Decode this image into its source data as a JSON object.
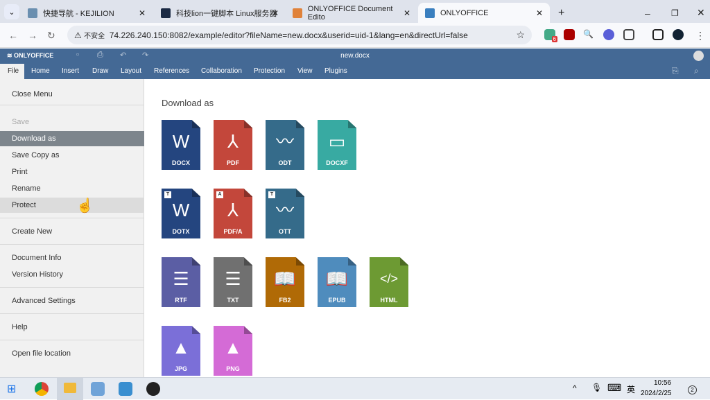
{
  "browser": {
    "tabs": [
      {
        "title": "快捷导航 - KEJILION",
        "color": "#6a8fb0"
      },
      {
        "title": "科技lion一键脚本 Linux服务器",
        "color": "#1b2a44"
      },
      {
        "title": "ONLYOFFICE Document Edito",
        "color": "#e0823a"
      },
      {
        "title": "ONLYOFFICE",
        "color": "#3a7fbf"
      }
    ],
    "new_tab": "+",
    "insecure_label": "不安全",
    "url": "74.226.240.150:8082/example/editor?fileName=new.docx&userid=uid-1&lang=en&directUrl=false",
    "ext_badge": "6"
  },
  "editor": {
    "logo": "ONLYOFFICE",
    "doc_title": "new.docx",
    "tabs": [
      "File",
      "Home",
      "Insert",
      "Draw",
      "Layout",
      "References",
      "Collaboration",
      "Protection",
      "View",
      "Plugins"
    ]
  },
  "menu": {
    "items": [
      {
        "label": "Close Menu",
        "state": ""
      },
      {
        "label": "Save",
        "state": "disabled"
      },
      {
        "label": "Download as",
        "state": "selected"
      },
      {
        "label": "Save Copy as",
        "state": ""
      },
      {
        "label": "Print",
        "state": ""
      },
      {
        "label": "Rename",
        "state": ""
      },
      {
        "label": "Protect",
        "state": "hover"
      },
      {
        "label": "Create New",
        "state": ""
      },
      {
        "label": "Document Info",
        "state": ""
      },
      {
        "label": "Version History",
        "state": ""
      },
      {
        "label": "Advanced Settings",
        "state": ""
      },
      {
        "label": "Help",
        "state": ""
      },
      {
        "label": "Open file location",
        "state": ""
      }
    ]
  },
  "download": {
    "title": "Download as",
    "rows": [
      [
        {
          "label": "DOCX",
          "glyph": "W",
          "color": "#24457f"
        },
        {
          "label": "PDF",
          "glyph": "⅄",
          "color": "#c3473b"
        },
        {
          "label": "ODT",
          "glyph": "〰",
          "color": "#356b8a"
        },
        {
          "label": "DOCXF",
          "glyph": "▭",
          "color": "#38aaa2"
        }
      ],
      [
        {
          "label": "DOTX",
          "glyph": "W",
          "color": "#24457f",
          "badge": "T"
        },
        {
          "label": "PDF/A",
          "glyph": "⅄",
          "color": "#c3473b",
          "badge": "A"
        },
        {
          "label": "OTT",
          "glyph": "〰",
          "color": "#356b8a",
          "badge": "T"
        }
      ],
      [
        {
          "label": "RTF",
          "glyph": "☰",
          "color": "#5b5ea4"
        },
        {
          "label": "TXT",
          "glyph": "☰",
          "color": "#707070"
        },
        {
          "label": "FB2",
          "glyph": "📖",
          "color": "#b06a06"
        },
        {
          "label": "EPUB",
          "glyph": "📖",
          "color": "#4f8cbd"
        },
        {
          "label": "HTML",
          "glyph": "</>",
          "color": "#6d9a33"
        }
      ],
      [
        {
          "label": "JPG",
          "glyph": "▲",
          "color": "#7b6fd8"
        },
        {
          "label": "PNG",
          "glyph": "▲",
          "color": "#d46bd6"
        }
      ]
    ]
  },
  "taskbar": {
    "ime": "英",
    "time": "10:56",
    "date": "2024/2/25",
    "notif": "2"
  }
}
